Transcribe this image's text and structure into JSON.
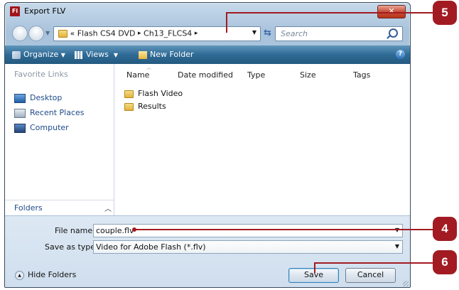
{
  "window": {
    "app_icon": "Fl",
    "title": "Export FLV",
    "close_label": "✕"
  },
  "address_bar": {
    "chevrons": "«",
    "path": [
      "Flash CS4 DVD",
      "Ch13_FLCS4"
    ],
    "separator": "▸"
  },
  "search": {
    "placeholder": "Search"
  },
  "toolbar": {
    "organize": "Organize",
    "views": "Views",
    "new_folder": "New Folder",
    "help": "?"
  },
  "nav_pane": {
    "heading": "Favorite Links",
    "links": [
      "Desktop",
      "Recent Places",
      "Computer"
    ],
    "folders_label": "Folders"
  },
  "file_list": {
    "columns": [
      "Name",
      "Date modified",
      "Type",
      "Size",
      "Tags"
    ],
    "items": [
      "Flash Video",
      "Results"
    ]
  },
  "save_form": {
    "file_name_label": "File name:",
    "file_name_value": "couple.flv",
    "save_type_label": "Save as type:",
    "save_type_value": "Video for Adobe Flash (*.flv)"
  },
  "buttons": {
    "hide_folders": "Hide Folders",
    "save": "Save",
    "cancel": "Cancel"
  },
  "callouts": [
    "5",
    "4",
    "6"
  ],
  "colors": {
    "callout": "#a21b22",
    "toolbar": "#2f6b96"
  }
}
